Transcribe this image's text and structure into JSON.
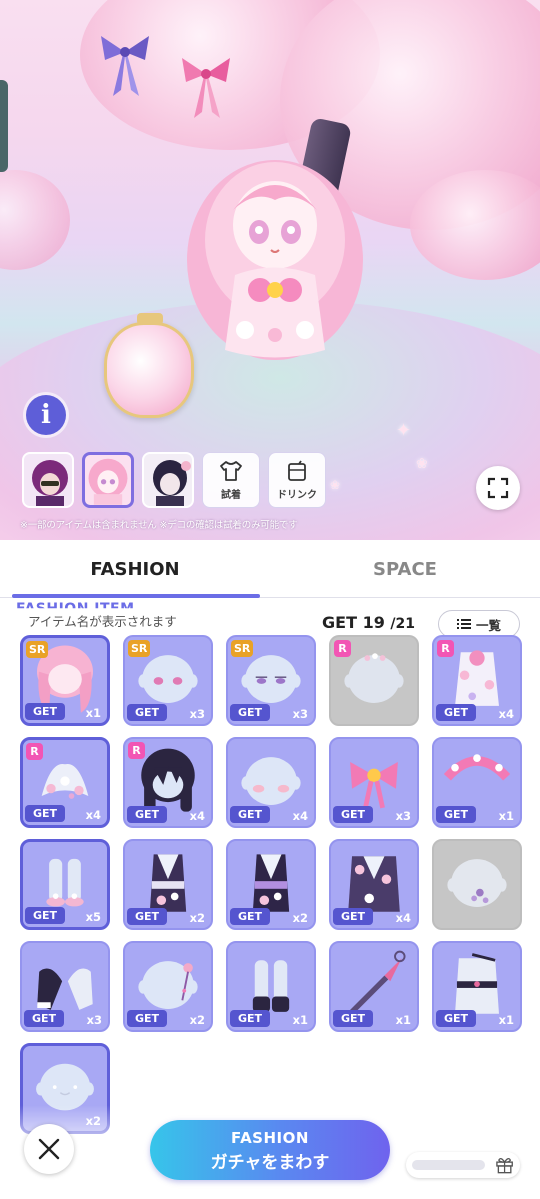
{
  "scene": {
    "info_label": "i",
    "notice": "※一部のアイテムは含まれません ※デコの確認は試着のみ可能です",
    "actions": [
      {
        "label": "試着",
        "icon": "shirt-icon"
      },
      {
        "label": "ドリンク",
        "icon": "drink-icon"
      }
    ]
  },
  "tabs": [
    {
      "label": "FASHION",
      "active": true
    },
    {
      "label": "SPACE",
      "active": false
    }
  ],
  "panel": {
    "section_title": "FASHION ITEM",
    "name_placeholder": "アイテム名が表示されます",
    "get_label": "GET",
    "get_count": "19",
    "get_total": "/21",
    "list_button": "一覧"
  },
  "items": [
    {
      "rarity": "SR",
      "get": "GET",
      "qty": "x1",
      "kind": "hair-pink",
      "selected": true
    },
    {
      "rarity": "SR",
      "get": "GET",
      "qty": "x3",
      "kind": "eyes-pink"
    },
    {
      "rarity": "SR",
      "get": "GET",
      "qty": "x3",
      "kind": "eyes-purple"
    },
    {
      "rarity": "R",
      "get": "",
      "qty": "",
      "kind": "deco-gray",
      "gray": true
    },
    {
      "rarity": "R",
      "get": "GET",
      "qty": "x4",
      "kind": "kimono-white"
    },
    {
      "rarity": "R",
      "get": "GET",
      "qty": "x4",
      "kind": "flower-clip",
      "selected": true
    },
    {
      "rarity": "R",
      "get": "GET",
      "qty": "x4",
      "kind": "hair-black"
    },
    {
      "rarity": "",
      "get": "GET",
      "qty": "x4",
      "kind": "blush"
    },
    {
      "rarity": "",
      "get": "GET",
      "qty": "x3",
      "kind": "bow-pink"
    },
    {
      "rarity": "",
      "get": "GET",
      "qty": "x1",
      "kind": "headband-pink"
    },
    {
      "rarity": "",
      "get": "GET",
      "qty": "x5",
      "kind": "sandals",
      "selected": true
    },
    {
      "rarity": "",
      "get": "GET",
      "qty": "x2",
      "kind": "kimono-dark-1"
    },
    {
      "rarity": "",
      "get": "GET",
      "qty": "x2",
      "kind": "kimono-dark-2"
    },
    {
      "rarity": "",
      "get": "GET",
      "qty": "x4",
      "kind": "kimono-dark-3"
    },
    {
      "rarity": "",
      "get": "",
      "qty": "",
      "kind": "face-gray",
      "gray": true
    },
    {
      "rarity": "",
      "get": "GET",
      "qty": "x3",
      "kind": "arm-sleeves"
    },
    {
      "rarity": "",
      "get": "GET",
      "qty": "x2",
      "kind": "hairpin"
    },
    {
      "rarity": "",
      "get": "GET",
      "qty": "x1",
      "kind": "boots"
    },
    {
      "rarity": "",
      "get": "GET",
      "qty": "x1",
      "kind": "kunai"
    },
    {
      "rarity": "",
      "get": "GET",
      "qty": "x1",
      "kind": "ninja-outfit"
    },
    {
      "rarity": "",
      "get": "",
      "qty": "x2",
      "kind": "face-mark",
      "selected": true
    }
  ],
  "bottom": {
    "gacha_line1": "FASHION",
    "gacha_line2": "ガチャをまわす"
  },
  "colors": {
    "accent": "#6b6de6",
    "card_bg": "#a8a8f4",
    "rarity_sr": "#e9a227",
    "rarity_r": "#f255b4",
    "get_badge": "#5555cf"
  }
}
